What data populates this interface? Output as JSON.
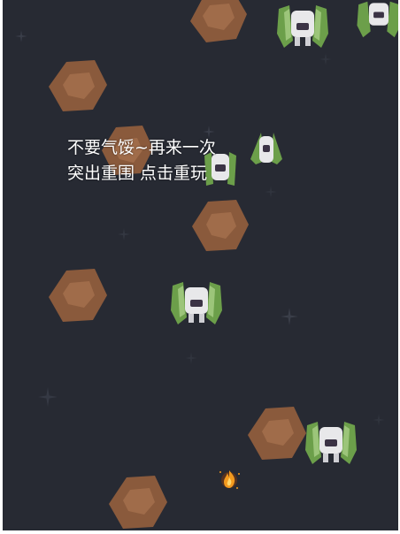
{
  "game": {
    "message_line1": "不要气馁~再来一次",
    "message_line2": "突出重围 点击重玩"
  },
  "colors": {
    "background": "#272a33",
    "asteroid": "#8a5a3c",
    "asteroid_highlight": "#a06c4a",
    "ship_wing": "#6c9f4a",
    "ship_body": "#e8e8ea",
    "flame": "#f39a1e"
  },
  "sprites": {
    "player": "flame-icon",
    "enemy": "fighter-ship-icon",
    "obstacle": "asteroid-icon"
  }
}
